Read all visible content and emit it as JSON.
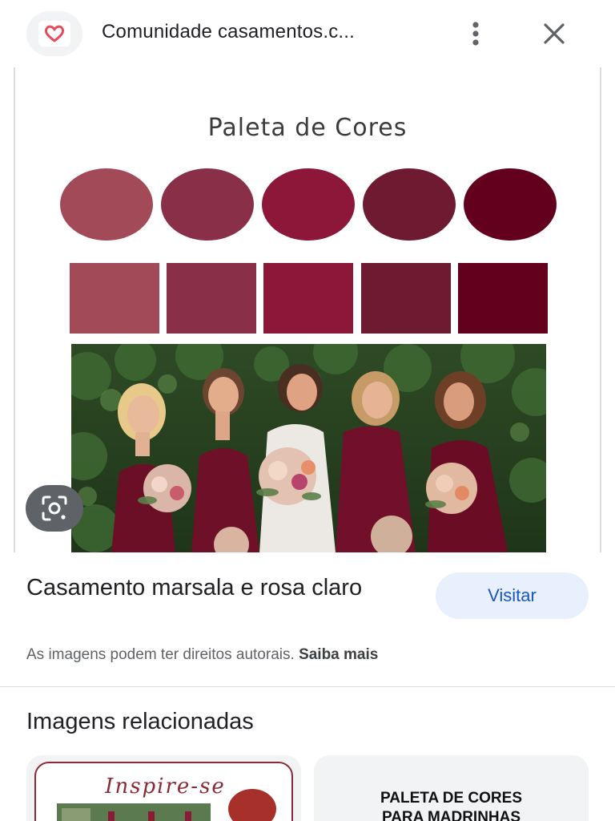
{
  "header": {
    "site_title": "Comunidade casamentos.c...",
    "logo_icon": "heart-icon",
    "menu_icon": "more-vert-icon",
    "close_icon": "close-icon"
  },
  "preview": {
    "palette_title": "Paleta de Cores",
    "swatch_colors": [
      "#a24a58",
      "#8a2f48",
      "#8c1738",
      "#6e1a30",
      "#62001e"
    ],
    "lens_icon": "google-lens-icon"
  },
  "result": {
    "title": "Casamento marsala e rosa claro",
    "visit_label": "Visitar",
    "copyright_text": "As imagens podem ter direitos autorais.",
    "learn_more": "Saiba mais"
  },
  "related": {
    "heading": "Imagens relacionadas",
    "card1_text": "Inspire-se",
    "card2_line1": "PALETA DE CORES",
    "card2_line2": "PARA MADRINHAS"
  },
  "colors": {
    "accent_blue": "#1a56c4",
    "visit_bg": "#e8f0fe",
    "heart": "#e94b5b"
  }
}
